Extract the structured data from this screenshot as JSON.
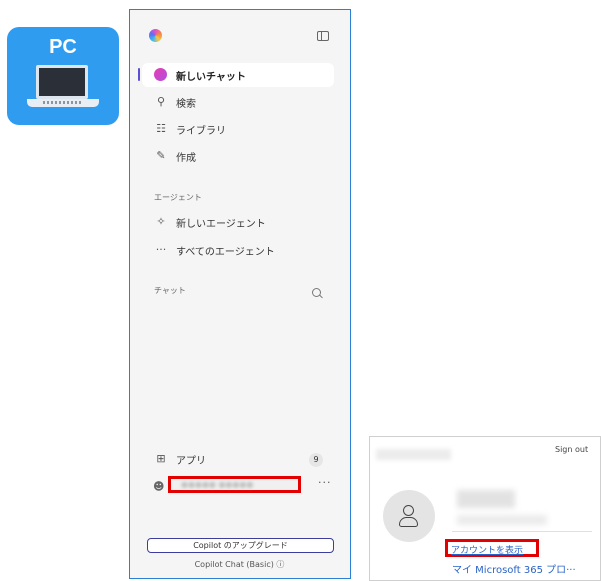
{
  "badge": {
    "label": "PC",
    "icon": "laptop-icon",
    "color": "#2f9cf0"
  },
  "sidebar": {
    "nav": [
      {
        "label": "新しいチャット",
        "icon": "new-chat-icon"
      },
      {
        "label": "検索",
        "icon": "search-icon"
      },
      {
        "label": "ライブラリ",
        "icon": "library-icon"
      },
      {
        "label": "作成",
        "icon": "create-icon"
      }
    ],
    "agents_header": "エージェント",
    "agents": [
      {
        "label": "新しいエージェント",
        "icon": "new-agent-icon"
      },
      {
        "label": "すべてのエージェント",
        "icon": "more-icon"
      }
    ],
    "chats_header": "チャット",
    "apps_label": "アプリ",
    "apps_count": "9",
    "upgrade_label": "Copilot のアップグレード",
    "plan_label": "Copilot Chat (Basic)"
  },
  "account_popup": {
    "sign_out": "Sign out",
    "view_account": "アカウントを表示",
    "my_microsoft": "マイ Microsoft 365 プロ···"
  },
  "colors": {
    "highlight": "#e30000",
    "link": "#2a63c7",
    "sidebar_border": "#2b7fd4"
  }
}
